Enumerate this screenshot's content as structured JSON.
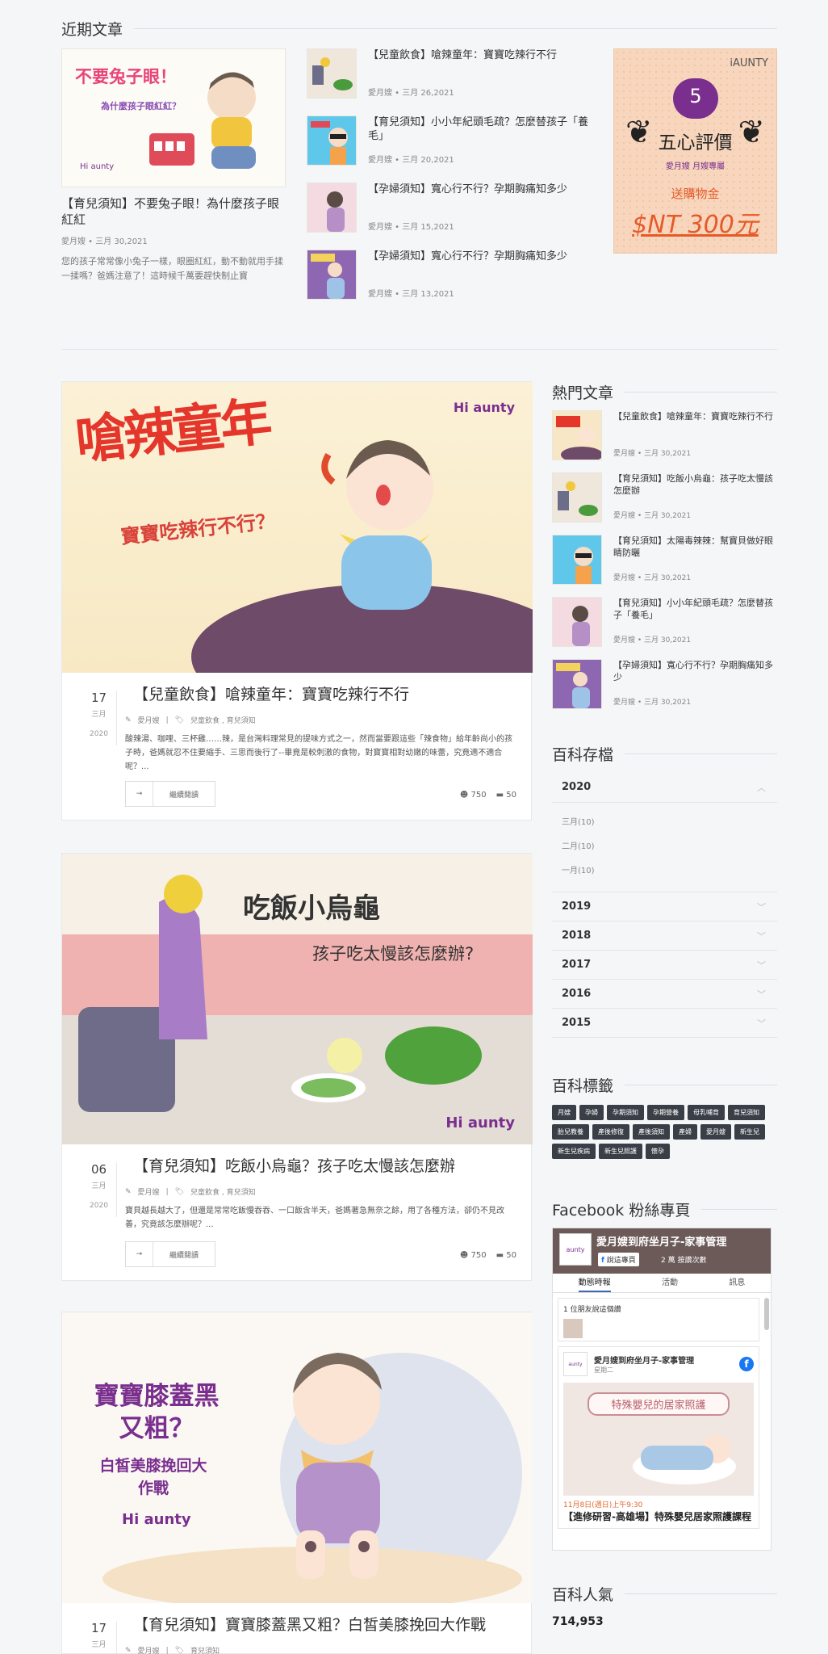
{
  "recent": {
    "title": "近期文章",
    "feature": {
      "img_line1": "不要兔子眼！",
      "img_line2": "為什麼孩子眼紅紅？",
      "title": "【育兒須知】不要兔子眼！為什麼孩子眼紅紅",
      "meta": "愛月嫂 • 三月 30,2021",
      "excerpt": "您的孩子常常像小兔子一樣，眼圈紅紅，動不動就用手揉一揉嗎？爸媽注意了！這時候千萬要趕快制止寶"
    },
    "items": [
      {
        "title": "【兒童飲食】嗆辣童年：寶寶吃辣行不行",
        "meta": "愛月嫂 • 三月 26,2021"
      },
      {
        "title": "【育兒須知】小小年紀頭毛疏？怎麼替孩子「養毛」",
        "meta": "愛月嫂 • 三月 20,2021"
      },
      {
        "title": "【孕婦須知】寬心行不行？孕期胸痛知多少",
        "meta": "愛月嫂 • 三月 15,2021"
      },
      {
        "title": "【孕婦須知】寬心行不行？孕期胸痛知多少",
        "meta": "愛月嫂 • 三月 13,2021"
      }
    ]
  },
  "ad": {
    "brand": "iAUNTY",
    "heart": "5",
    "title": "五心評價",
    "sub": "愛月嫂 月嫂專屬",
    "gift": "送購物金",
    "price": "$NT 300元"
  },
  "posts": [
    {
      "img_title": "嗆辣童年",
      "img_sub": "寶寶吃辣行不行？",
      "day": "17",
      "month": "三月",
      "year": "2020",
      "title": "【兒童飲食】嗆辣童年：寶寶吃辣行不行",
      "author": "愛月嫂",
      "cats": "兒童飲食 , 育兒須知",
      "excerpt": "酸辣湯、咖哩、三杯雞……辣，是台灣料理常見的提味方式之一，然而當要跟這些「辣食物」給年齡尚小的孩子時，爸媽就忍不住要縮手、三思而後行了--畢竟是較刺激的食物，對寶寶相對幼嫩的味蕾，究竟適不適合呢？...",
      "read": "繼續閱讀",
      "views": "750",
      "comments": "50"
    },
    {
      "img_title": "吃飯小烏龜",
      "img_sub": "孩子吃太慢該怎麼辦?",
      "day": "06",
      "month": "三月",
      "year": "2020",
      "title": "【育兒須知】吃飯小烏龜？孩子吃太慢該怎麼辦",
      "author": "愛月嫂",
      "cats": "兒童飲食 , 育兒須知",
      "excerpt": "寶貝越長越大了，但還是常常吃飯慢吞吞、一口飯含半天，爸媽著急無奈之餘，用了各種方法，卻仍不見改善，究竟該怎麼辦呢？...",
      "read": "繼續閱讀",
      "views": "750",
      "comments": "50"
    },
    {
      "img_title": "寶寶膝蓋黑又粗？",
      "img_sub": "白皙美膝挽回大作戰",
      "day": "17",
      "month": "三月",
      "year": "",
      "title": "【育兒須知】寶寶膝蓋黑又粗？白皙美膝挽回大作戰",
      "author": "愛月嫂",
      "cats": "育兒須知"
    }
  ],
  "logo": {
    "hi": "Hi",
    "name": "aunty",
    "cn": "愛月嫂"
  },
  "hot": {
    "title": "熱門文章",
    "items": [
      {
        "title": "【兒童飲食】嗆辣童年：寶寶吃辣行不行",
        "meta": "愛月嫂 • 三月 30,2021"
      },
      {
        "title": "【育兒須知】吃飯小烏龜：孩子吃太慢該怎麼辦",
        "meta": "愛月嫂 • 三月 30,2021"
      },
      {
        "title": "【育兒須知】太陽毒辣辣：幫寶貝做好眼睛防曬",
        "meta": "愛月嫂 • 三月 30,2021"
      },
      {
        "title": "【育兒須知】小小年紀頭毛疏？怎麼替孩子「養毛」",
        "meta": "愛月嫂 • 三月 30,2021"
      },
      {
        "title": "【孕婦須知】寬心行不行？孕期胸痛知多少",
        "meta": "愛月嫂 • 三月 30,2021"
      }
    ]
  },
  "archive": {
    "title": "百科存檔",
    "open_year": "2020",
    "months": [
      "三月(10)",
      "二月(10)",
      "一月(10)"
    ],
    "years": [
      "2019",
      "2018",
      "2017",
      "2016",
      "2015"
    ]
  },
  "tags": {
    "title": "百科標籤",
    "items": [
      "月嫂",
      "孕婦",
      "孕期須知",
      "孕期營養",
      "母乳哺育",
      "育兒須知",
      "胎兒教養",
      "產後修復",
      "產後須知",
      "產婦",
      "愛月嫂",
      "新生兒",
      "新生兒疾病",
      "新生兒照護",
      "懷孕"
    ]
  },
  "facebook": {
    "title": "Facebook 粉絲專頁",
    "page_name": "愛月嫂到府坐月子-家事管理",
    "like": "說這專頁",
    "likes": "2 萬 按讚次數",
    "tabs": [
      "動態時報",
      "活動",
      "訊息"
    ],
    "friends": "1 位朋友說這個讚",
    "post_name": "愛月嫂到府坐月子-家事管理",
    "post_time": "星期二",
    "post_banner": "特殊嬰兒的居家照護",
    "post_date": "11月8日(週日)上午9:30",
    "post_title": "【進修研習-高雄場】特殊嬰兒居家照護課程"
  },
  "popularity": {
    "title": "百科人氣",
    "count": "714,953"
  }
}
